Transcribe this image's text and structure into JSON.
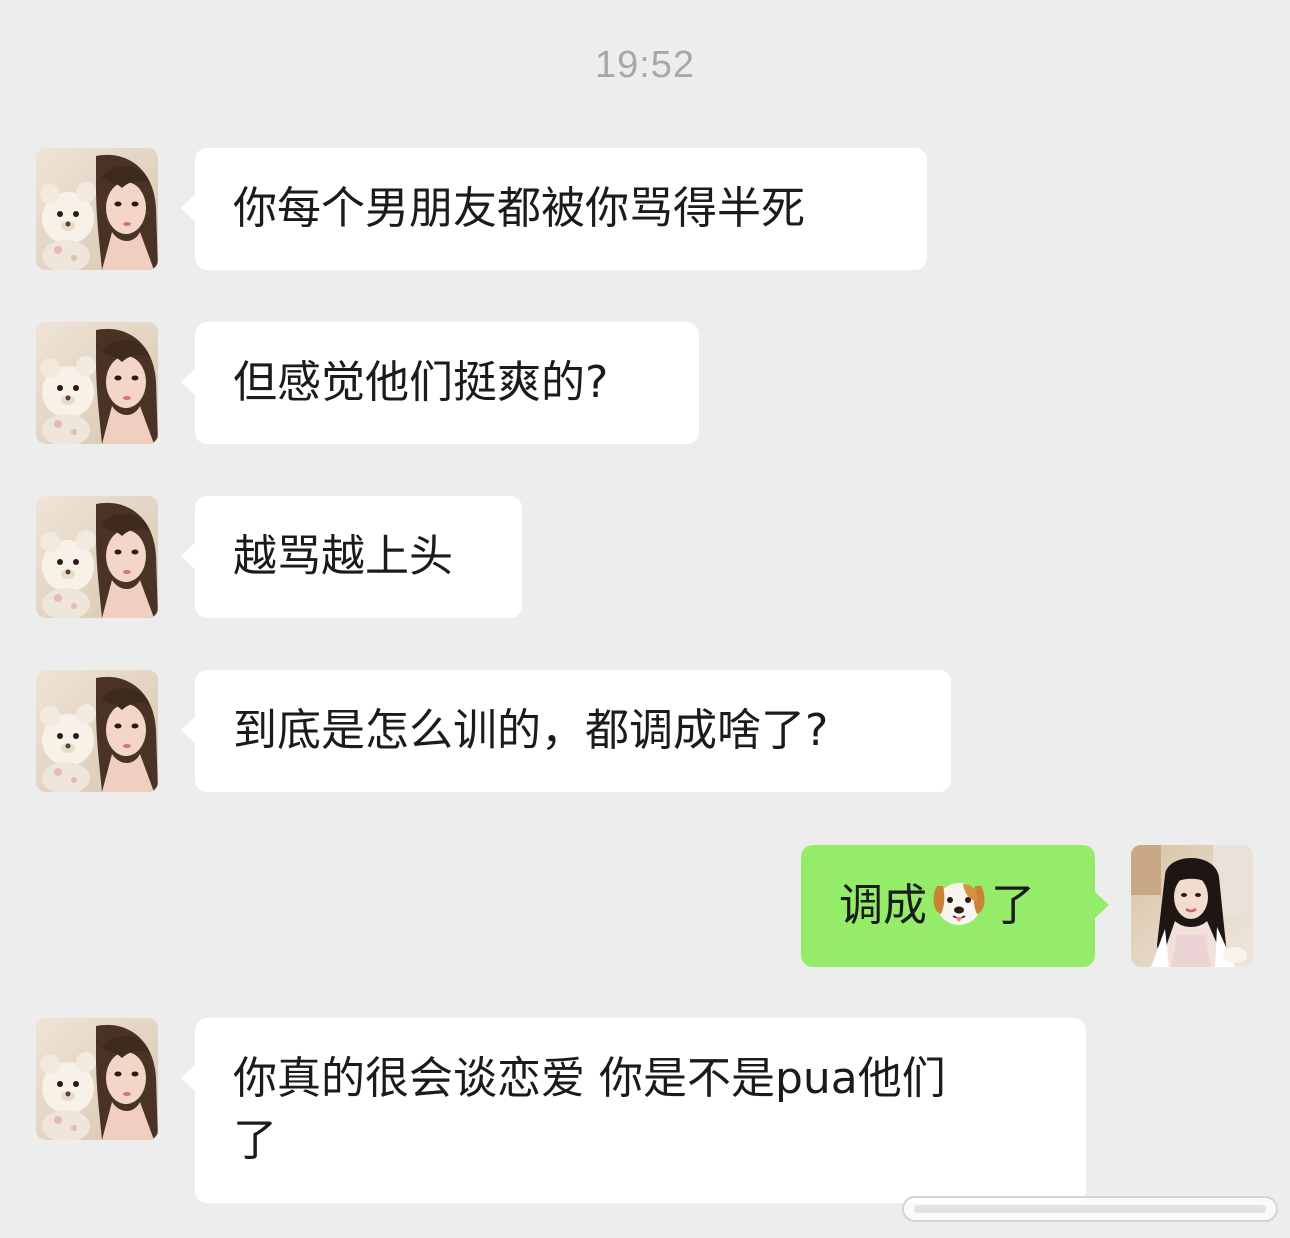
{
  "timestamp": "19:52",
  "contact_avatar_icon": "avatar-girl-with-teddy-bear",
  "self_avatar_icon": "avatar-girl-long-hair",
  "messages": [
    {
      "sender": "contact",
      "text": "你每个男朋友都被你骂得半死"
    },
    {
      "sender": "contact",
      "text": "但感觉他们挺爽的?"
    },
    {
      "sender": "contact",
      "text": "越骂越上头"
    },
    {
      "sender": "contact",
      "text": "到底是怎么训的，都调成啥了?"
    },
    {
      "sender": "self",
      "text_before": "调成",
      "emoji": "dog-face-icon",
      "text_after": "了"
    },
    {
      "sender": "contact",
      "text_line1": "你真的很会谈恋爱 你是不是pua他们",
      "text_line2": "了"
    }
  ],
  "colors": {
    "background": "#ededed",
    "incoming_bubble": "#ffffff",
    "outgoing_bubble": "#95ec69",
    "timestamp_text": "#a8a8a8"
  }
}
